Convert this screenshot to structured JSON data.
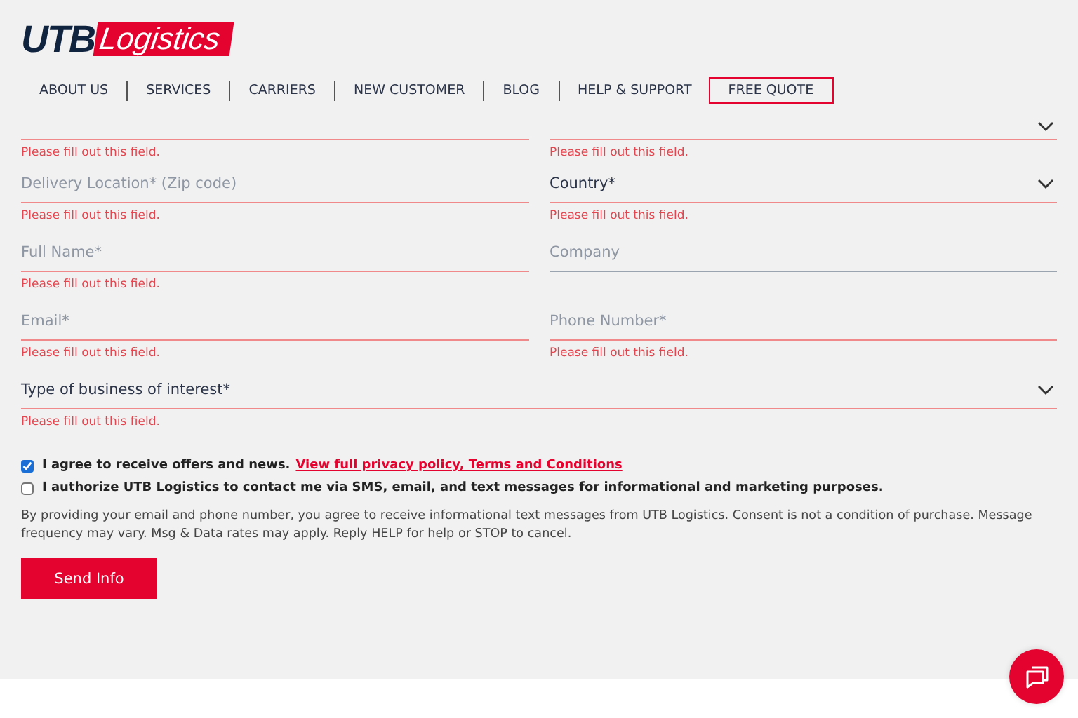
{
  "logo": {
    "mark": "UTB",
    "word": "Logistics"
  },
  "nav": [
    {
      "label": "ABOUT US",
      "kind": "link"
    },
    {
      "label": "SERVICES",
      "kind": "link"
    },
    {
      "label": "CARRIERS",
      "kind": "link"
    },
    {
      "label": "NEW CUSTOMER",
      "kind": "link"
    },
    {
      "label": "BLOG",
      "kind": "link"
    },
    {
      "label": "HELP & SUPPORT",
      "kind": "link"
    },
    {
      "label": "FREE QUOTE",
      "kind": "outlined"
    }
  ],
  "form_rows": [
    [
      {
        "kind": "input",
        "invalid": true,
        "error": "Please fill out this field."
      },
      {
        "kind": "select",
        "invalid": true,
        "error": "Please fill out this field."
      }
    ],
    [
      {
        "kind": "input",
        "placeholder": "Delivery Location* (Zip code)",
        "invalid": true,
        "error": "Please fill out this field."
      },
      {
        "kind": "select",
        "value": "Country*",
        "invalid": true,
        "error": "Please fill out this field."
      }
    ],
    [
      {
        "kind": "input",
        "placeholder": "Full Name*",
        "invalid": true,
        "error": "Please fill out this field."
      },
      {
        "kind": "input",
        "placeholder": "Company",
        "invalid": false
      }
    ],
    [
      {
        "kind": "input",
        "placeholder": "Email*",
        "invalid": true,
        "error": "Please fill out this field."
      },
      {
        "kind": "input",
        "placeholder": "Phone Number*",
        "invalid": true,
        "error": "Please fill out this field."
      }
    ],
    [
      {
        "kind": "select",
        "value": "Type of business of interest*",
        "invalid": true,
        "error": "Please fill out this field."
      }
    ]
  ],
  "consents": [
    {
      "label": "I agree to receive offers and news.",
      "link": "View full privacy policy, Terms and Conditions",
      "checked": true
    },
    {
      "label": "I authorize UTB Logistics to contact me via SMS, email, and text messages for informational and marketing purposes.",
      "checked": false
    }
  ],
  "disclaimer": "By providing your email and phone number, you agree to receive informational text messages from UTB Logistics. Consent is not a condition of purchase. Message frequency may vary. Msg & Data rates may apply. Reply HELP for help or STOP to cancel.",
  "submit": "Send Info"
}
